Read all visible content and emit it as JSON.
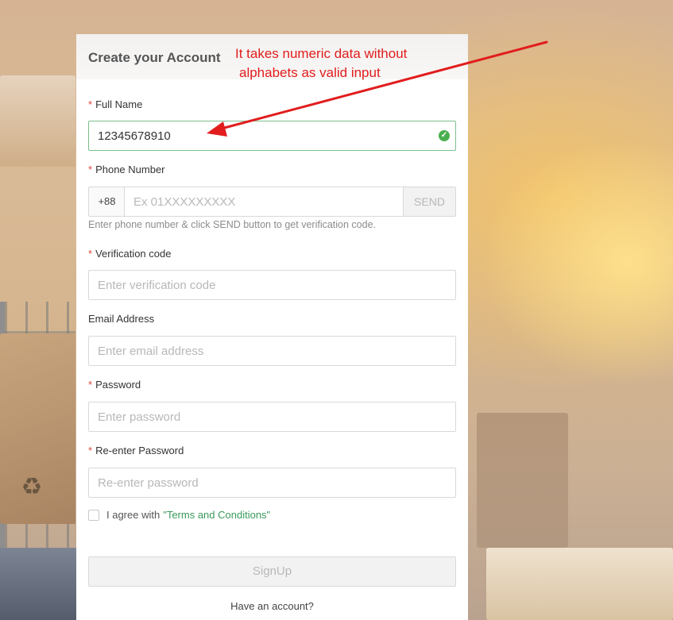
{
  "page": {
    "card_title": "Create your Account",
    "annotation": {
      "line1": "It takes numeric data without",
      "line2": "alphabets as valid input",
      "color": "#e11d1d"
    }
  },
  "form": {
    "required_mark": "*",
    "full_name": {
      "label": "Full Name",
      "value": "12345678910",
      "status": "valid",
      "status_icon": "check-circle-icon"
    },
    "phone": {
      "label": "Phone Number",
      "prefix": "+88",
      "placeholder": "Ex 01XXXXXXXXX",
      "send_label": "SEND",
      "hint": "Enter phone number & click SEND button to get verification code."
    },
    "verification": {
      "label": "Verification code",
      "placeholder": "Enter verification code"
    },
    "email": {
      "label": "Email Address",
      "placeholder": "Enter email address"
    },
    "password": {
      "label": "Password",
      "placeholder": "Enter password"
    },
    "reenter_password": {
      "label": "Re-enter Password",
      "placeholder": "Re-enter password"
    },
    "agree": {
      "text": "I agree with",
      "terms_link": "\"Terms and Conditions\""
    },
    "signup_label": "SignUp",
    "have_account": "Have an account?"
  },
  "colors": {
    "accent_green": "#3a9a5b",
    "valid_green": "#4caf50",
    "required_red": "#e1463c"
  }
}
